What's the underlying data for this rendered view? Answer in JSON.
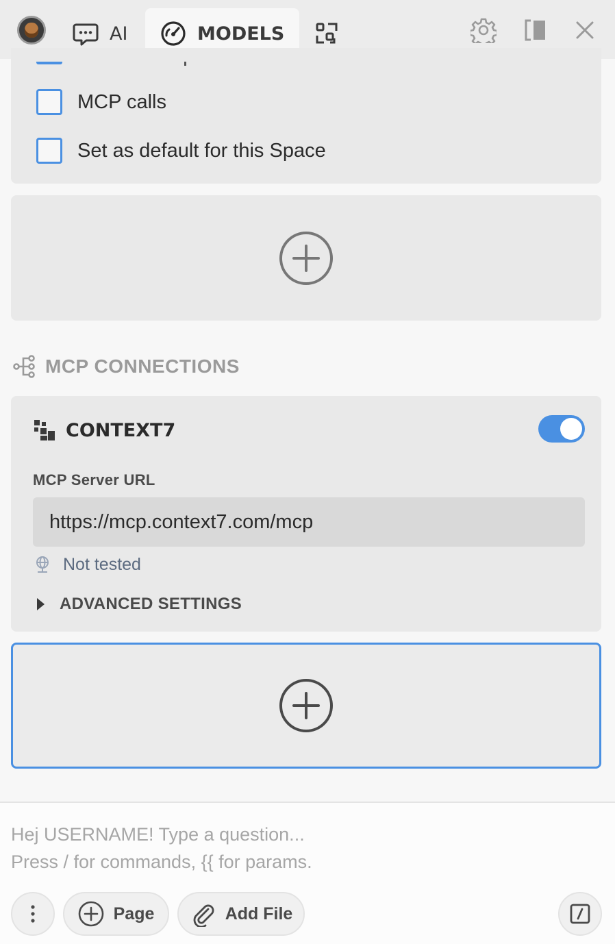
{
  "tabs": {
    "ai_label": "AI",
    "models_label": "MODELS"
  },
  "model_options": {
    "items": [
      {
        "label": "MCP calls",
        "checked": false
      },
      {
        "label": "Set as default for this Space",
        "checked": false
      }
    ]
  },
  "mcp": {
    "section_title": "MCP CONNECTIONS",
    "connection": {
      "name": "CONTEXT7",
      "enabled": true,
      "url_label": "MCP Server URL",
      "url_value": "https://mcp.context7.com/mcp",
      "status": "Not tested",
      "advanced_label": "ADVANCED SETTINGS"
    }
  },
  "composer": {
    "placeholder": "Hej USERNAME! Type a question...\nPress / for commands, {{ for params.",
    "page_label": "Page",
    "add_file_label": "Add File"
  },
  "colors": {
    "accent": "#4a90e2",
    "panel": "#e9e9e9",
    "background": "#f7f7f7"
  },
  "icons": [
    "avatar",
    "chat-icon",
    "gauge-icon",
    "tools-icon",
    "gear-icon",
    "split-view-icon",
    "close-icon",
    "add-circle-icon",
    "connections-icon",
    "context7-logo-icon",
    "globe-icon",
    "caret-right-icon",
    "more-vertical-icon",
    "paperclip-icon",
    "slash-command-icon"
  ]
}
